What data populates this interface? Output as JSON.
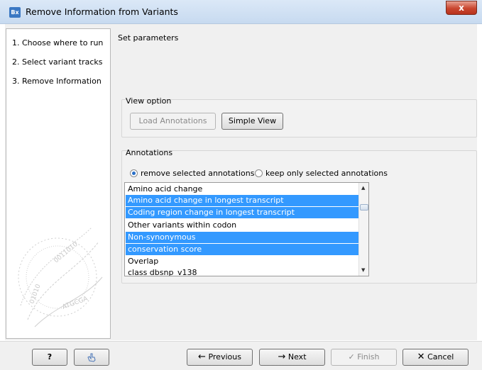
{
  "window": {
    "icon_text": "Bx",
    "title": "Remove Information from Variants",
    "close_symbol": "x"
  },
  "steps": [
    {
      "label": "1.  Choose where to run"
    },
    {
      "label": "2.  Select variant tracks"
    },
    {
      "label": "3.  Remove Information"
    }
  ],
  "main": {
    "title": "Set parameters",
    "view_option": {
      "label": "View option",
      "load_annotations": "Load Annotations",
      "simple_view": "Simple View"
    },
    "annotations": {
      "label": "Annotations",
      "radio_remove": "remove selected annotations",
      "radio_keep": "keep only selected annotations",
      "selected_radio": "remove selected annotations",
      "items": [
        {
          "label": "Amino acid change",
          "selected": false
        },
        {
          "label": "Amino acid change in longest transcript",
          "selected": true
        },
        {
          "label": "Coding region change in longest transcript",
          "selected": true
        },
        {
          "label": "Other variants within codon",
          "selected": false
        },
        {
          "label": "Non-synonymous",
          "selected": true
        },
        {
          "label": "conservation score",
          "selected": true
        },
        {
          "label": "Overlap",
          "selected": false
        },
        {
          "label": "class dbsnp_v138",
          "selected": false
        }
      ]
    }
  },
  "footer": {
    "help": "?",
    "previous": "Previous",
    "next": "Next",
    "finish": "Finish",
    "cancel": "Cancel"
  },
  "colors": {
    "selection": "#3399ff",
    "titlebar": "#c7daf0",
    "close_button": "#c9462f"
  }
}
